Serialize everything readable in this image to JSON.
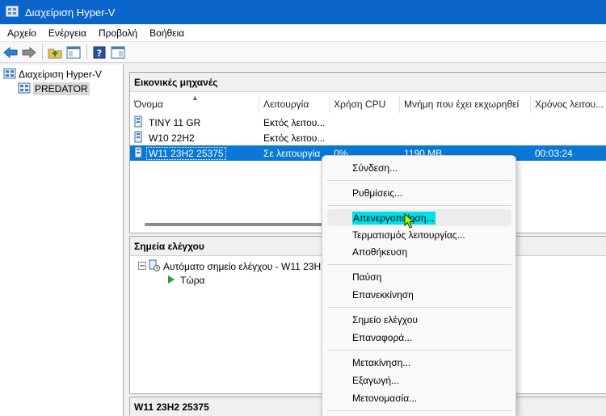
{
  "window": {
    "title": "Διαχείριση Hyper-V"
  },
  "menubar": {
    "items": [
      "Αρχείο",
      "Ενέργεια",
      "Προβολή",
      "Βοήθεια"
    ]
  },
  "toolbar": {
    "buttons": [
      "back-arrow-icon",
      "forward-arrow-icon",
      "up-folder-icon",
      "show-tree-icon",
      "help-icon",
      "action-pane-icon"
    ]
  },
  "tree": {
    "root": "Διαχείριση Hyper-V",
    "server": "PREDATOR"
  },
  "vm_pane": {
    "title": "Εικονικές μηχανές",
    "columns": [
      "Όνομα",
      "Λειτουργία",
      "Χρήση CPU",
      "Μνήμη που έχει εκχωρηθεί",
      "Χρόνος λειτου..."
    ],
    "rows": [
      {
        "name": "TINY 11 GR",
        "state": "Εκτός λειτου...",
        "cpu": "",
        "memory": "",
        "uptime": ""
      },
      {
        "name": "W10 22H2",
        "state": "Εκτός λειτου...",
        "cpu": "",
        "memory": "",
        "uptime": ""
      },
      {
        "name": "W11 23H2 25375",
        "state": "Σε λειτουργία",
        "cpu": "0%",
        "memory": "1190 MB",
        "uptime": "00:03:24"
      }
    ]
  },
  "checkpoints_pane": {
    "title": "Σημεία ελέγχου",
    "items": [
      "Αυτόματο σημείο ελέγχου - W11 23H2",
      "Τώρα"
    ]
  },
  "bottom_pane": {
    "title": "W11 23H2 25375"
  },
  "context_menu": {
    "items": [
      "Σύνδεση...",
      "Ρυθμίσεις...",
      "Απενεργοποίηση...",
      "Τερματισμός λειτουργίας...",
      "Αποθήκευση",
      "Παύση",
      "Επανεκκίνηση",
      "Σημείο ελέγχου",
      "Επαναφορά...",
      "Μετακίνηση...",
      "Εξαγωγή...",
      "Μετονομασία..."
    ],
    "highlighted": "Απενεργοποίηση..."
  },
  "colors": {
    "titlebar": "#0a64c9",
    "selection": "#0a78d7",
    "highlight": "#00e0e8"
  }
}
